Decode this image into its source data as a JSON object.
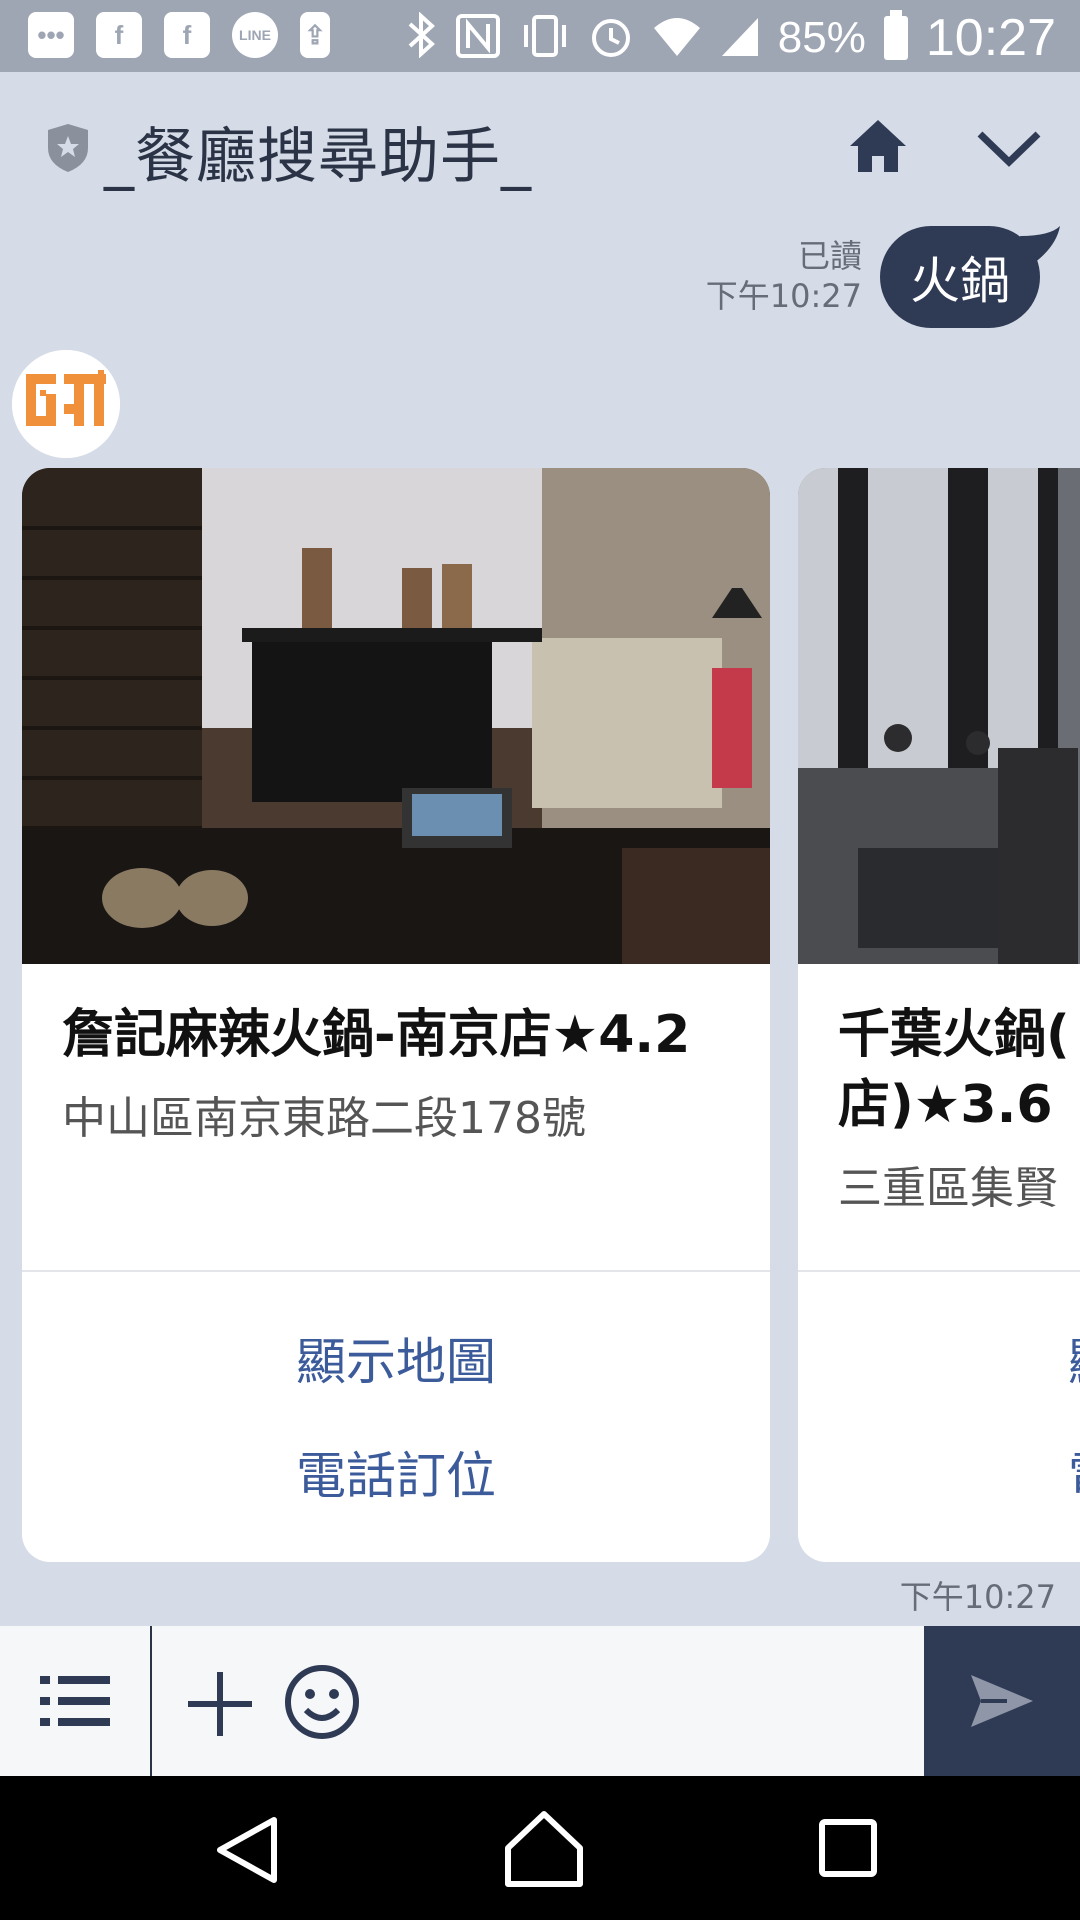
{
  "status_bar": {
    "battery": "85%",
    "time": "10:27",
    "notification_icons": [
      "more-icon",
      "facebook-icon",
      "facebook-icon",
      "line-icon",
      "download-icon"
    ],
    "system_icons": [
      "bluetooth-icon",
      "nfc-icon",
      "vibrate-icon",
      "alarm-icon",
      "wifi-icon",
      "signal-icon",
      "battery-icon"
    ]
  },
  "header": {
    "title": "_餐廳搜尋助手_"
  },
  "sent_message": {
    "read_status": "已讀",
    "time": "下午10:27",
    "text": "火鍋"
  },
  "cards": [
    {
      "name": "詹記麻辣火鍋-南京店★4.2",
      "address": "中山區南京東路二段178號",
      "actions": [
        "顯示地圖",
        "電話訂位"
      ]
    },
    {
      "name": "千葉火鍋(",
      "name_line2": "店)★3.6",
      "address": "三重區集賢",
      "actions": [
        "顯",
        "電"
      ]
    }
  ],
  "carousel_time": "下午10:27",
  "input_bar": {
    "placeholder": ""
  },
  "colors": {
    "background": "#d6dce7",
    "status_bar": "#9ea5b3",
    "bubble": "#2f3a55",
    "action_text": "#3c5b9a",
    "send_button": "#2f3a55"
  }
}
